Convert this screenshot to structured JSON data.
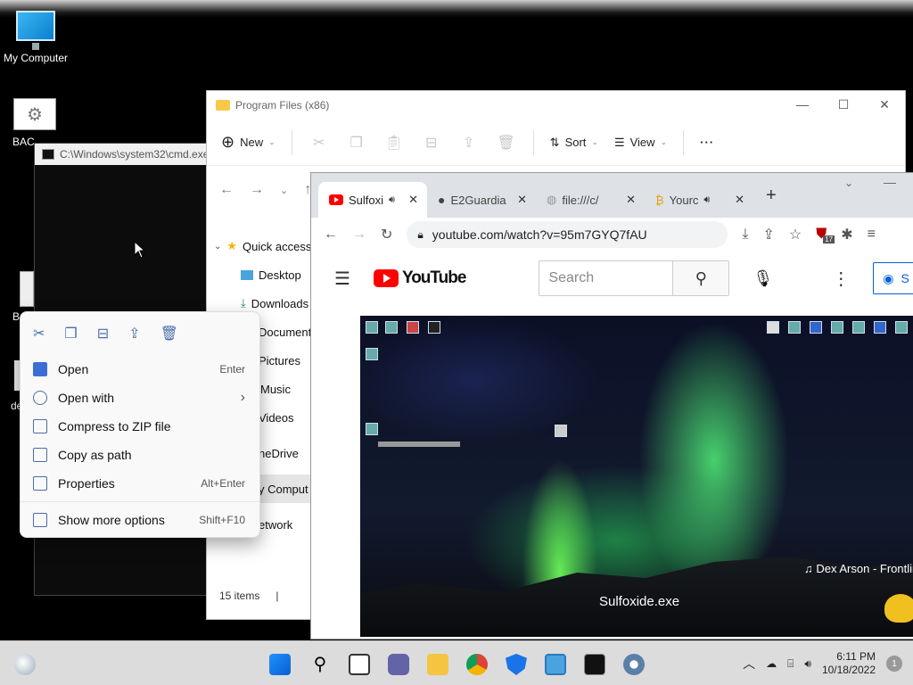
{
  "desktop": {
    "icons": [
      {
        "label": "My Computer"
      },
      {
        "label": "BAC"
      },
      {
        "label": "B"
      },
      {
        "label": "de"
      }
    ]
  },
  "cmd": {
    "title": "C:\\Windows\\system32\\cmd.exe"
  },
  "explorer": {
    "title": "Program Files (x86)",
    "toolbar": {
      "new_label": "New",
      "sort_label": "Sort",
      "view_label": "View",
      "more_label": "···"
    },
    "tree": [
      {
        "label": "Quick access"
      },
      {
        "label": "Desktop"
      },
      {
        "label": "Downloads"
      },
      {
        "label": "Documents"
      },
      {
        "label": "Pictures"
      },
      {
        "label": "Music"
      },
      {
        "label": "Videos"
      },
      {
        "label": "neDrive"
      },
      {
        "label": "y Comput"
      },
      {
        "label": "etwork"
      }
    ],
    "status": "15 items"
  },
  "chrome": {
    "tabs": [
      {
        "label": "Sulfoxi",
        "active": true
      },
      {
        "label": "E2Guardia"
      },
      {
        "label": "file:///c/"
      },
      {
        "label": "Yourc"
      }
    ],
    "new_tab": "+",
    "url": "youtube.com/watch?v=95m7GYQ7fAU",
    "ext_badge": "17"
  },
  "youtube": {
    "logo_text": "YouTube",
    "search_placeholder": "Search",
    "sign_in": "S",
    "video_caption": "Sulfoxide.exe",
    "song": "♫ Dex Arson - Frontlin"
  },
  "context_menu": {
    "items": [
      {
        "label": "Open",
        "shortcut": "Enter"
      },
      {
        "label": "Open with",
        "shortcut": "›"
      },
      {
        "label": "Compress to ZIP file",
        "shortcut": ""
      },
      {
        "label": "Copy as path",
        "shortcut": ""
      },
      {
        "label": "Properties",
        "shortcut": "Alt+Enter"
      },
      {
        "label": "Show more options",
        "shortcut": "Shift+F10"
      }
    ]
  },
  "taskbar": {
    "time": "6:11 PM",
    "date": "10/18/2022",
    "notifications": "1"
  },
  "colors": {
    "accent": "#0067c0",
    "youtube_red": "#ff0000",
    "taskbar": "#dcdcdc"
  }
}
